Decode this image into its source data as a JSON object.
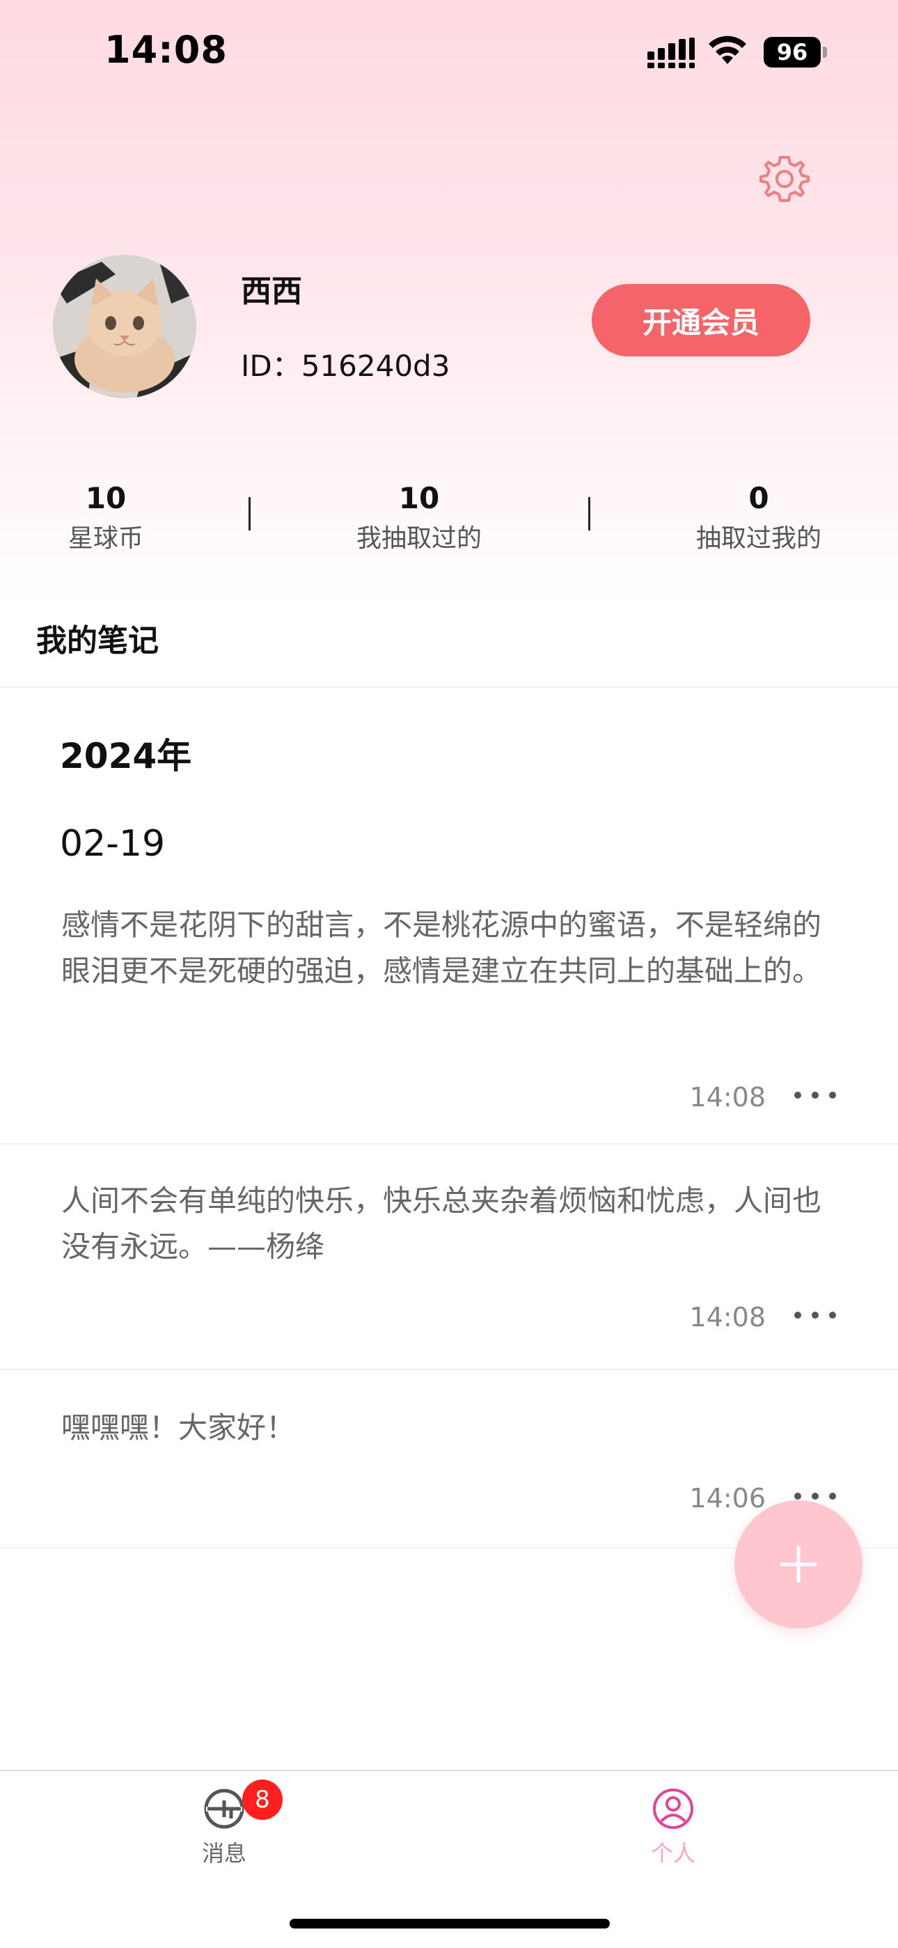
{
  "status_bar": {
    "time": "14:08",
    "battery": "96"
  },
  "profile": {
    "username": "西西",
    "user_id": "ID：516240d3",
    "vip_button": "开通会员"
  },
  "stats": [
    {
      "value": "10",
      "label": "星球币"
    },
    {
      "value": "10",
      "label": "我抽取过的"
    },
    {
      "value": "0",
      "label": "抽取过我的"
    }
  ],
  "notes_section": {
    "title": "我的笔记",
    "year": "2024年",
    "date": "02-19",
    "items": [
      {
        "text": "感情不是花阴下的甜言，不是桃花源中的蜜语，不是轻绵的眼泪更不是死硬的强迫，感情是建立在共同上的基础上的。",
        "time": "14:08"
      },
      {
        "text": "人间不会有单纯的快乐，快乐总夹杂着烦恼和忧虑，人间也没有永远。——杨绛",
        "time": "14:08"
      },
      {
        "text": "嘿嘿嘿！大家好！",
        "time": "14:06"
      }
    ]
  },
  "tab_bar": {
    "messages": {
      "label": "消息",
      "badge": "8"
    },
    "profile": {
      "label": "个人"
    }
  },
  "colors": {
    "accent": "#f56468",
    "fab": "#ffc6cf",
    "tab_active": "#e2439a",
    "tab_active_label": "#f9a3c5",
    "badge": "#ff1f1f"
  },
  "icons": {
    "settings": "gear-icon",
    "add": "plus-icon",
    "more": "more-dots-icon",
    "messages_tab": "message-icon",
    "profile_tab": "person-icon"
  }
}
